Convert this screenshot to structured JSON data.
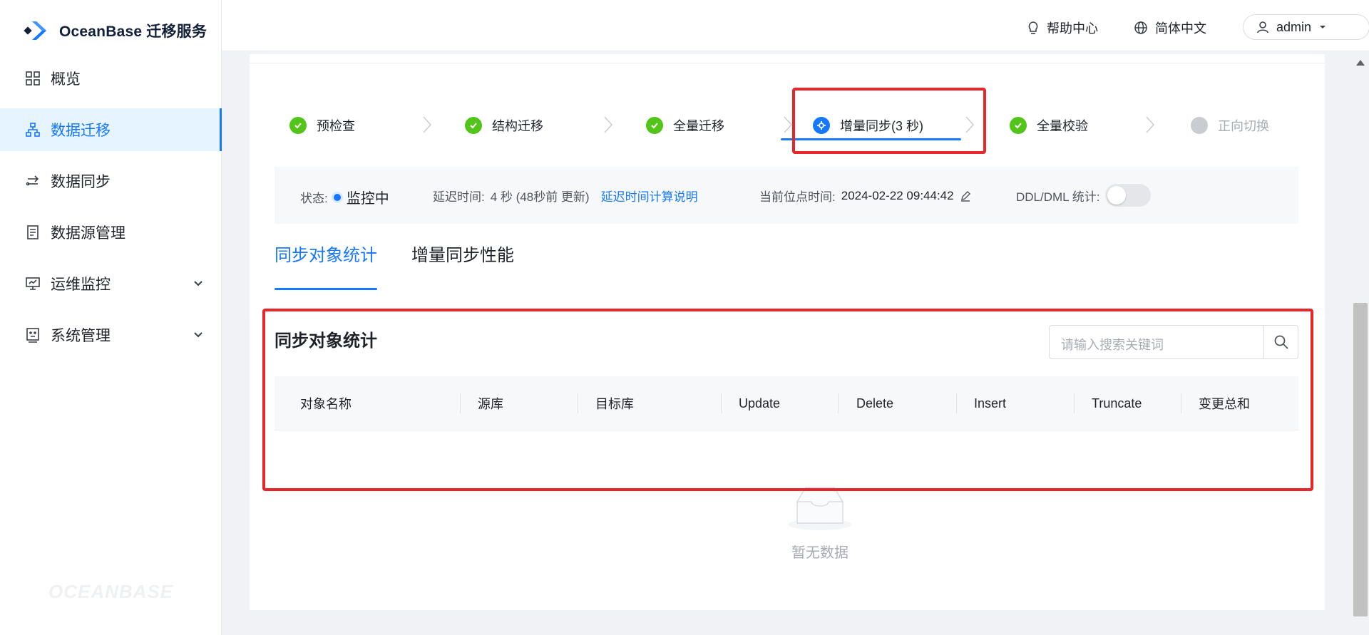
{
  "app": {
    "brand_name": "OceanBase",
    "brand_suffix": "迁移服务",
    "watermark": "OCEANBASE"
  },
  "sidebar": {
    "items": [
      {
        "label": "概览",
        "icon": "grid-icon"
      },
      {
        "label": "数据迁移",
        "icon": "hierarchy-icon",
        "active": true
      },
      {
        "label": "数据同步",
        "icon": "sync-arrows-icon"
      },
      {
        "label": "数据源管理",
        "icon": "database-doc-icon"
      },
      {
        "label": "运维监控",
        "icon": "monitor-icon",
        "expandable": true
      },
      {
        "label": "系统管理",
        "icon": "system-icon",
        "expandable": true
      }
    ]
  },
  "header": {
    "help": "帮助中心",
    "language": "简体中文",
    "user": "admin"
  },
  "steps": [
    {
      "label": "预检查",
      "status": "done"
    },
    {
      "label": "结构迁移",
      "status": "done"
    },
    {
      "label": "全量迁移",
      "status": "done"
    },
    {
      "label": "增量同步(3 秒)",
      "status": "active"
    },
    {
      "label": "全量校验",
      "status": "done"
    },
    {
      "label": "正向切换",
      "status": "pending"
    }
  ],
  "status_bar": {
    "state_label": "状态:",
    "state_value": "监控中",
    "delay_label": "延迟时间:",
    "delay_value": "4 秒 (48秒前 更新)",
    "delay_link": "延迟时间计算说明",
    "position_label": "当前位点时间:",
    "position_value": "2024-02-22 09:44:42",
    "ddl_label": "DDL/DML 统计:",
    "ddl_enabled": false
  },
  "tabs": [
    {
      "label": "同步对象统计",
      "active": true
    },
    {
      "label": "增量同步性能",
      "active": false
    }
  ],
  "section": {
    "title": "同步对象统计",
    "search_placeholder": "请输入搜索关键词"
  },
  "table": {
    "columns": [
      "对象名称",
      "源库",
      "目标库",
      "Update",
      "Delete",
      "Insert",
      "Truncate",
      "变更总和"
    ],
    "rows": [],
    "empty_text": "暂无数据"
  },
  "colors": {
    "primary": "#1677ff",
    "success": "#52c41a",
    "highlight": "#e8262a"
  }
}
